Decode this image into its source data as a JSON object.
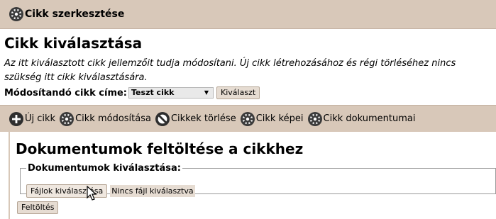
{
  "header": {
    "title": "Cikk szerkesztése",
    "icon": "gear-icon"
  },
  "section": {
    "title": "Cikk kiválasztása",
    "description": "Az itt kiválasztott cikk jellemzőit tudja módosítani. Új cikk létrehozásához és régi törléséhez nincs szükség itt cikk kiválasztására.",
    "select_label": "Módosítandó cikk címe:",
    "select_value": "Teszt cikk",
    "select_button": "Kiválaszt"
  },
  "toolbar": {
    "items": [
      {
        "label": "Új cikk",
        "icon": "plus-icon"
      },
      {
        "label": "Cikk módosítása",
        "icon": "gear-icon"
      },
      {
        "label": "Cikkek törlése",
        "icon": "forbidden-icon"
      },
      {
        "label": "Cikk képei",
        "icon": "gear-icon"
      },
      {
        "label": "Cikk dokumentumai",
        "icon": "gear-icon"
      }
    ]
  },
  "upload_panel": {
    "title": "Dokumentumok feltöltése a cikkhez",
    "legend": "Dokumentumok kiválasztása:",
    "file_button": "Fájlok kiválasztása",
    "file_status": "Nincs fájl kiválasztva",
    "upload_button": "Feltöltés"
  },
  "colors": {
    "bar": "#d8c8b9",
    "icon_dark": "#2e2e2e"
  }
}
